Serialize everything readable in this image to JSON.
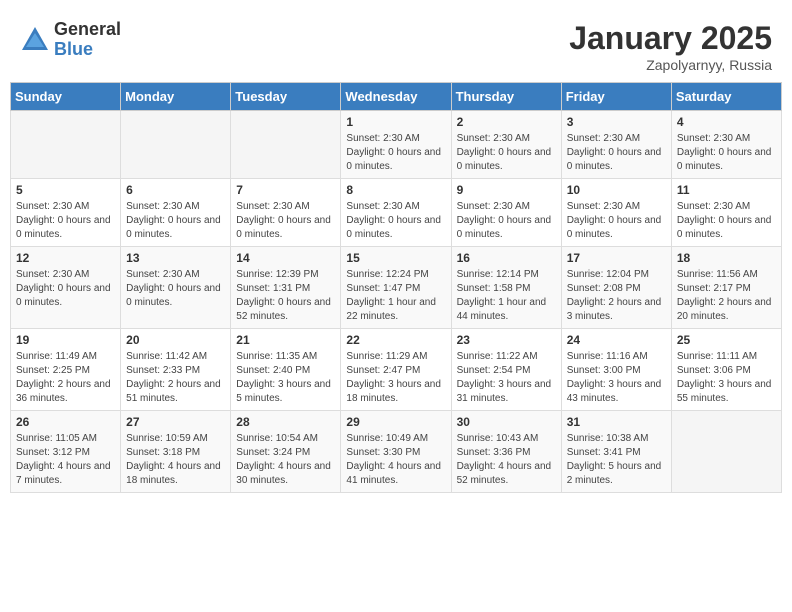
{
  "header": {
    "logo_general": "General",
    "logo_blue": "Blue",
    "month_title": "January 2025",
    "location": "Zapolyarnyy, Russia"
  },
  "days_of_week": [
    "Sunday",
    "Monday",
    "Tuesday",
    "Wednesday",
    "Thursday",
    "Friday",
    "Saturday"
  ],
  "weeks": [
    {
      "cells": [
        {
          "day": "",
          "info": ""
        },
        {
          "day": "",
          "info": ""
        },
        {
          "day": "",
          "info": ""
        },
        {
          "day": "1",
          "info": "Sunset: 2:30 AM\nDaylight: 0 hours and 0 minutes."
        },
        {
          "day": "2",
          "info": "Sunset: 2:30 AM\nDaylight: 0 hours and 0 minutes."
        },
        {
          "day": "3",
          "info": "Sunset: 2:30 AM\nDaylight: 0 hours and 0 minutes."
        },
        {
          "day": "4",
          "info": "Sunset: 2:30 AM\nDaylight: 0 hours and 0 minutes."
        }
      ]
    },
    {
      "cells": [
        {
          "day": "5",
          "info": "Sunset: 2:30 AM\nDaylight: 0 hours and 0 minutes."
        },
        {
          "day": "6",
          "info": "Sunset: 2:30 AM\nDaylight: 0 hours and 0 minutes."
        },
        {
          "day": "7",
          "info": "Sunset: 2:30 AM\nDaylight: 0 hours and 0 minutes."
        },
        {
          "day": "8",
          "info": "Sunset: 2:30 AM\nDaylight: 0 hours and 0 minutes."
        },
        {
          "day": "9",
          "info": "Sunset: 2:30 AM\nDaylight: 0 hours and 0 minutes."
        },
        {
          "day": "10",
          "info": "Sunset: 2:30 AM\nDaylight: 0 hours and 0 minutes."
        },
        {
          "day": "11",
          "info": "Sunset: 2:30 AM\nDaylight: 0 hours and 0 minutes."
        }
      ]
    },
    {
      "cells": [
        {
          "day": "12",
          "info": "Sunset: 2:30 AM\nDaylight: 0 hours and 0 minutes."
        },
        {
          "day": "13",
          "info": "Sunset: 2:30 AM\nDaylight: 0 hours and 0 minutes."
        },
        {
          "day": "14",
          "info": "Sunrise: 12:39 PM\nSunset: 1:31 PM\nDaylight: 0 hours and 52 minutes."
        },
        {
          "day": "15",
          "info": "Sunrise: 12:24 PM\nSunset: 1:47 PM\nDaylight: 1 hour and 22 minutes."
        },
        {
          "day": "16",
          "info": "Sunrise: 12:14 PM\nSunset: 1:58 PM\nDaylight: 1 hour and 44 minutes."
        },
        {
          "day": "17",
          "info": "Sunrise: 12:04 PM\nSunset: 2:08 PM\nDaylight: 2 hours and 3 minutes."
        },
        {
          "day": "18",
          "info": "Sunrise: 11:56 AM\nSunset: 2:17 PM\nDaylight: 2 hours and 20 minutes."
        }
      ]
    },
    {
      "cells": [
        {
          "day": "19",
          "info": "Sunrise: 11:49 AM\nSunset: 2:25 PM\nDaylight: 2 hours and 36 minutes."
        },
        {
          "day": "20",
          "info": "Sunrise: 11:42 AM\nSunset: 2:33 PM\nDaylight: 2 hours and 51 minutes."
        },
        {
          "day": "21",
          "info": "Sunrise: 11:35 AM\nSunset: 2:40 PM\nDaylight: 3 hours and 5 minutes."
        },
        {
          "day": "22",
          "info": "Sunrise: 11:29 AM\nSunset: 2:47 PM\nDaylight: 3 hours and 18 minutes."
        },
        {
          "day": "23",
          "info": "Sunrise: 11:22 AM\nSunset: 2:54 PM\nDaylight: 3 hours and 31 minutes."
        },
        {
          "day": "24",
          "info": "Sunrise: 11:16 AM\nSunset: 3:00 PM\nDaylight: 3 hours and 43 minutes."
        },
        {
          "day": "25",
          "info": "Sunrise: 11:11 AM\nSunset: 3:06 PM\nDaylight: 3 hours and 55 minutes."
        }
      ]
    },
    {
      "cells": [
        {
          "day": "26",
          "info": "Sunrise: 11:05 AM\nSunset: 3:12 PM\nDaylight: 4 hours and 7 minutes."
        },
        {
          "day": "27",
          "info": "Sunrise: 10:59 AM\nSunset: 3:18 PM\nDaylight: 4 hours and 18 minutes."
        },
        {
          "day": "28",
          "info": "Sunrise: 10:54 AM\nSunset: 3:24 PM\nDaylight: 4 hours and 30 minutes."
        },
        {
          "day": "29",
          "info": "Sunrise: 10:49 AM\nSunset: 3:30 PM\nDaylight: 4 hours and 41 minutes."
        },
        {
          "day": "30",
          "info": "Sunrise: 10:43 AM\nSunset: 3:36 PM\nDaylight: 4 hours and 52 minutes."
        },
        {
          "day": "31",
          "info": "Sunrise: 10:38 AM\nSunset: 3:41 PM\nDaylight: 5 hours and 2 minutes."
        },
        {
          "day": "",
          "info": ""
        }
      ]
    }
  ]
}
